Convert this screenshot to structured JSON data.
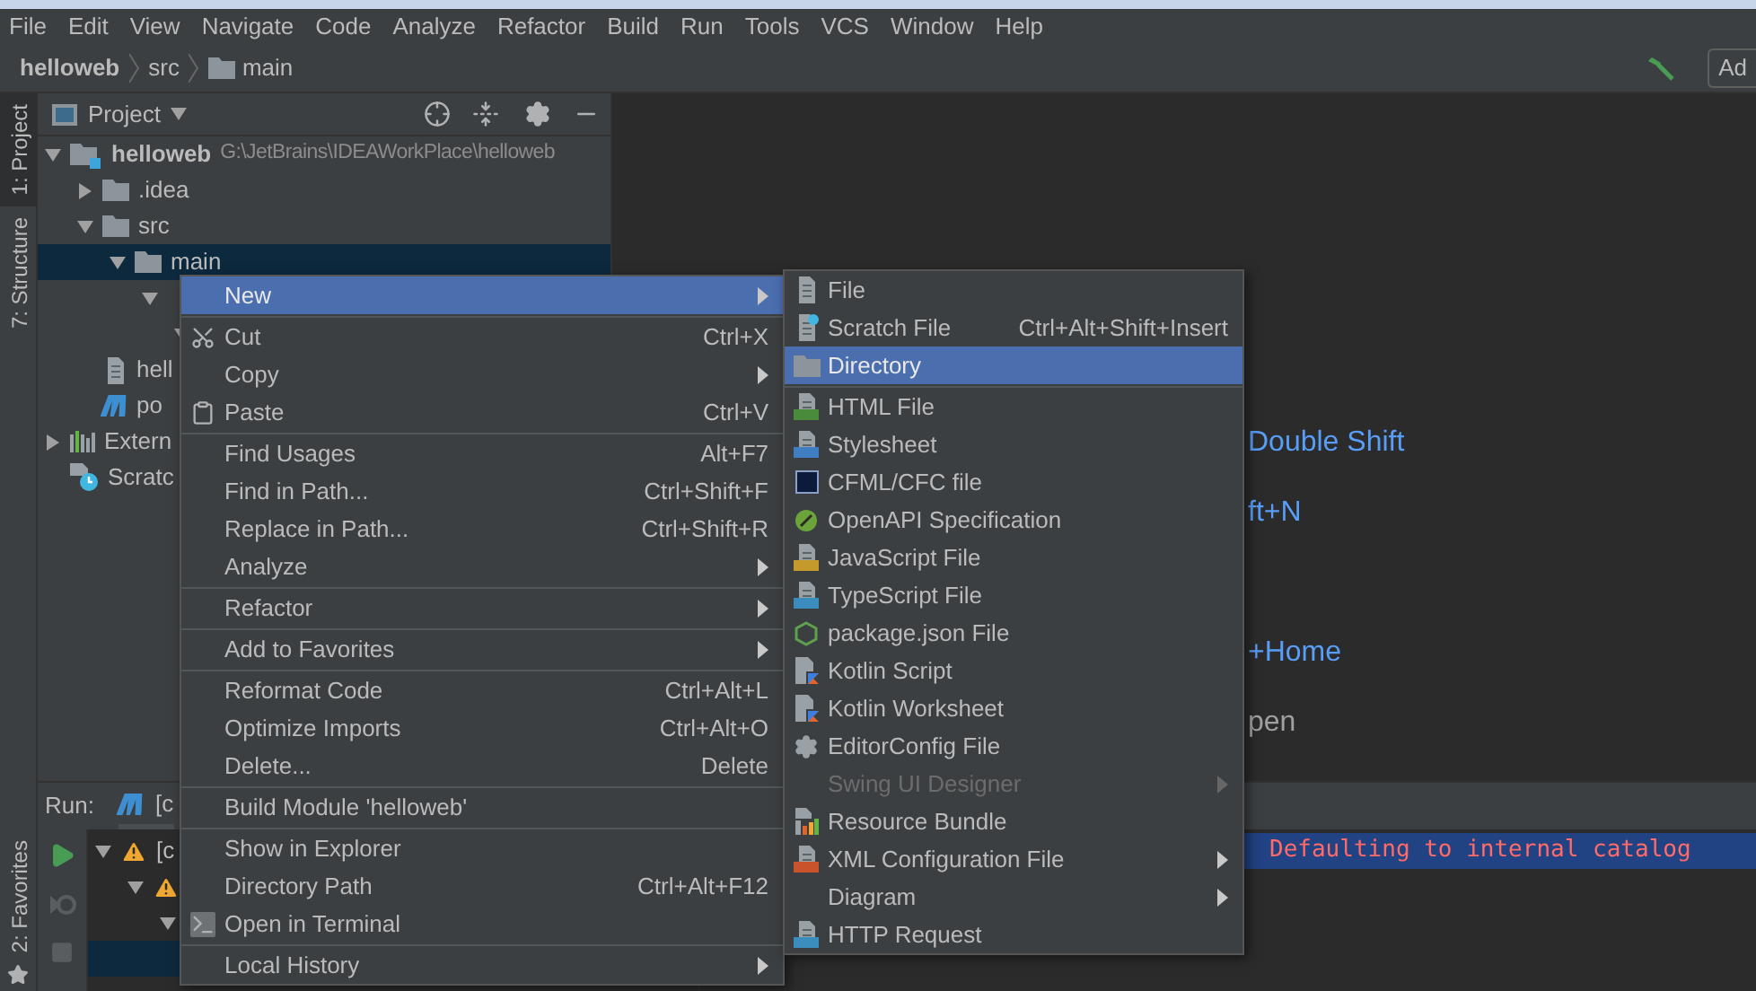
{
  "menu_bar": [
    "File",
    "Edit",
    "View",
    "Navigate",
    "Code",
    "Analyze",
    "Refactor",
    "Build",
    "Run",
    "Tools",
    "VCS",
    "Window",
    "Help"
  ],
  "breadcrumbs": [
    {
      "label": "helloweb",
      "kind": "project"
    },
    {
      "label": "src",
      "kind": "plain"
    },
    {
      "label": "main",
      "kind": "folder"
    }
  ],
  "toolbar": {
    "button": "Ad"
  },
  "left_tabs": [
    {
      "label": "1: Project",
      "selected": true
    },
    {
      "label": "7: Structure",
      "selected": false
    }
  ],
  "left_bottom_tabs": [
    {
      "label": "2: Favorites",
      "selected": false
    }
  ],
  "project_panel": {
    "title": "Project",
    "tree": [
      {
        "label": "helloweb",
        "path": "G:\\JetBrains\\IDEAWorkPlace\\helloweb",
        "kind": "module",
        "expanded": true,
        "selected": false,
        "children": [
          {
            "label": ".idea",
            "kind": "folder",
            "expanded": false,
            "selected": false
          },
          {
            "label": "src",
            "kind": "folder",
            "expanded": true,
            "selected": false,
            "children": [
              {
                "label": "main",
                "kind": "folder",
                "expanded": true,
                "selected": true,
                "children": [
                  {
                    "expanded": true,
                    "selected": false,
                    "children": [
                      {
                        "expanded": true,
                        "selected": false
                      }
                    ]
                  }
                ]
              }
            ]
          },
          {
            "label": "hell",
            "kind": "file",
            "selected": false
          },
          {
            "label": "po",
            "kind": "maven",
            "selected": false
          }
        ]
      },
      {
        "label": "Extern",
        "kind": "library",
        "expanded": false,
        "selected": false
      },
      {
        "label": "Scratc",
        "kind": "scratch",
        "selected": false
      }
    ]
  },
  "editor_hints": [
    {
      "text": "Double Shift",
      "kind": "shortcut"
    },
    {
      "text": "ft+N",
      "kind": "shortcut"
    },
    {
      "text": "+Home",
      "kind": "shortcut"
    },
    {
      "text": "pen",
      "kind": "plain"
    }
  ],
  "run_panel": {
    "title": "Run:",
    "tab": "[c",
    "tree": [
      {
        "label": "[c",
        "kind": "warning",
        "expanded": true,
        "selected": false,
        "children": [
          {
            "kind": "warning",
            "expanded": true,
            "selected": false,
            "children": [
              {
                "expanded": true,
                "selected": false,
                "children": [
                  {
                    "selected": true
                  }
                ]
              }
            ]
          }
        ]
      }
    ],
    "console": [
      {
        "text": "Defaulting to internal catalog",
        "selected": true
      }
    ]
  },
  "context_menu": {
    "groups": [
      [
        {
          "label": "New",
          "submenu": true,
          "selected": true
        }
      ],
      [
        {
          "label": "Cut",
          "shortcut": "Ctrl+X",
          "selected": false
        },
        {
          "label": "Copy",
          "submenu": true,
          "selected": false
        },
        {
          "label": "Paste",
          "shortcut": "Ctrl+V",
          "selected": false
        }
      ],
      [
        {
          "label": "Find Usages",
          "shortcut": "Alt+F7",
          "selected": false
        },
        {
          "label": "Find in Path...",
          "shortcut": "Ctrl+Shift+F",
          "selected": false
        },
        {
          "label": "Replace in Path...",
          "shortcut": "Ctrl+Shift+R",
          "selected": false
        },
        {
          "label": "Analyze",
          "submenu": true,
          "selected": false
        }
      ],
      [
        {
          "label": "Refactor",
          "submenu": true,
          "selected": false
        }
      ],
      [
        {
          "label": "Add to Favorites",
          "submenu": true,
          "selected": false
        }
      ],
      [
        {
          "label": "Reformat Code",
          "shortcut": "Ctrl+Alt+L",
          "selected": false
        },
        {
          "label": "Optimize Imports",
          "shortcut": "Ctrl+Alt+O",
          "selected": false
        },
        {
          "label": "Delete...",
          "shortcut": "Delete",
          "selected": false
        }
      ],
      [
        {
          "label": "Build Module 'helloweb'",
          "selected": false
        }
      ],
      [
        {
          "label": "Show in Explorer",
          "selected": false
        },
        {
          "label": "Directory Path",
          "shortcut": "Ctrl+Alt+F12",
          "selected": false
        },
        {
          "label": "Open in Terminal",
          "selected": false
        }
      ],
      [
        {
          "label": "Local History",
          "submenu": true,
          "selected": false
        }
      ]
    ]
  },
  "new_submenu": {
    "groups": [
      [
        {
          "label": "File",
          "selected": false,
          "disabled": false
        },
        {
          "label": "Scratch File",
          "shortcut": "Ctrl+Alt+Shift+Insert",
          "selected": false,
          "disabled": false
        },
        {
          "label": "Directory",
          "selected": true,
          "disabled": false
        }
      ],
      [
        {
          "label": "HTML File",
          "selected": false,
          "disabled": false
        },
        {
          "label": "Stylesheet",
          "selected": false,
          "disabled": false
        },
        {
          "label": "CFML/CFC file",
          "selected": false,
          "disabled": false
        },
        {
          "label": "OpenAPI Specification",
          "selected": false,
          "disabled": false
        },
        {
          "label": "JavaScript File",
          "selected": false,
          "disabled": false
        },
        {
          "label": "TypeScript File",
          "selected": false,
          "disabled": false
        },
        {
          "label": "package.json File",
          "selected": false,
          "disabled": false
        },
        {
          "label": "Kotlin Script",
          "selected": false,
          "disabled": false
        },
        {
          "label": "Kotlin Worksheet",
          "selected": false,
          "disabled": false
        },
        {
          "label": "EditorConfig File",
          "selected": false,
          "disabled": false
        },
        {
          "label": "Swing UI Designer",
          "submenu": true,
          "selected": false,
          "disabled": true
        },
        {
          "label": "Resource Bundle",
          "selected": false,
          "disabled": false
        },
        {
          "label": "XML Configuration File",
          "submenu": true,
          "selected": false,
          "disabled": false
        },
        {
          "label": "Diagram",
          "submenu": true,
          "selected": false,
          "disabled": false
        },
        {
          "label": "HTTP Request",
          "selected": false,
          "disabled": false
        }
      ]
    ]
  }
}
